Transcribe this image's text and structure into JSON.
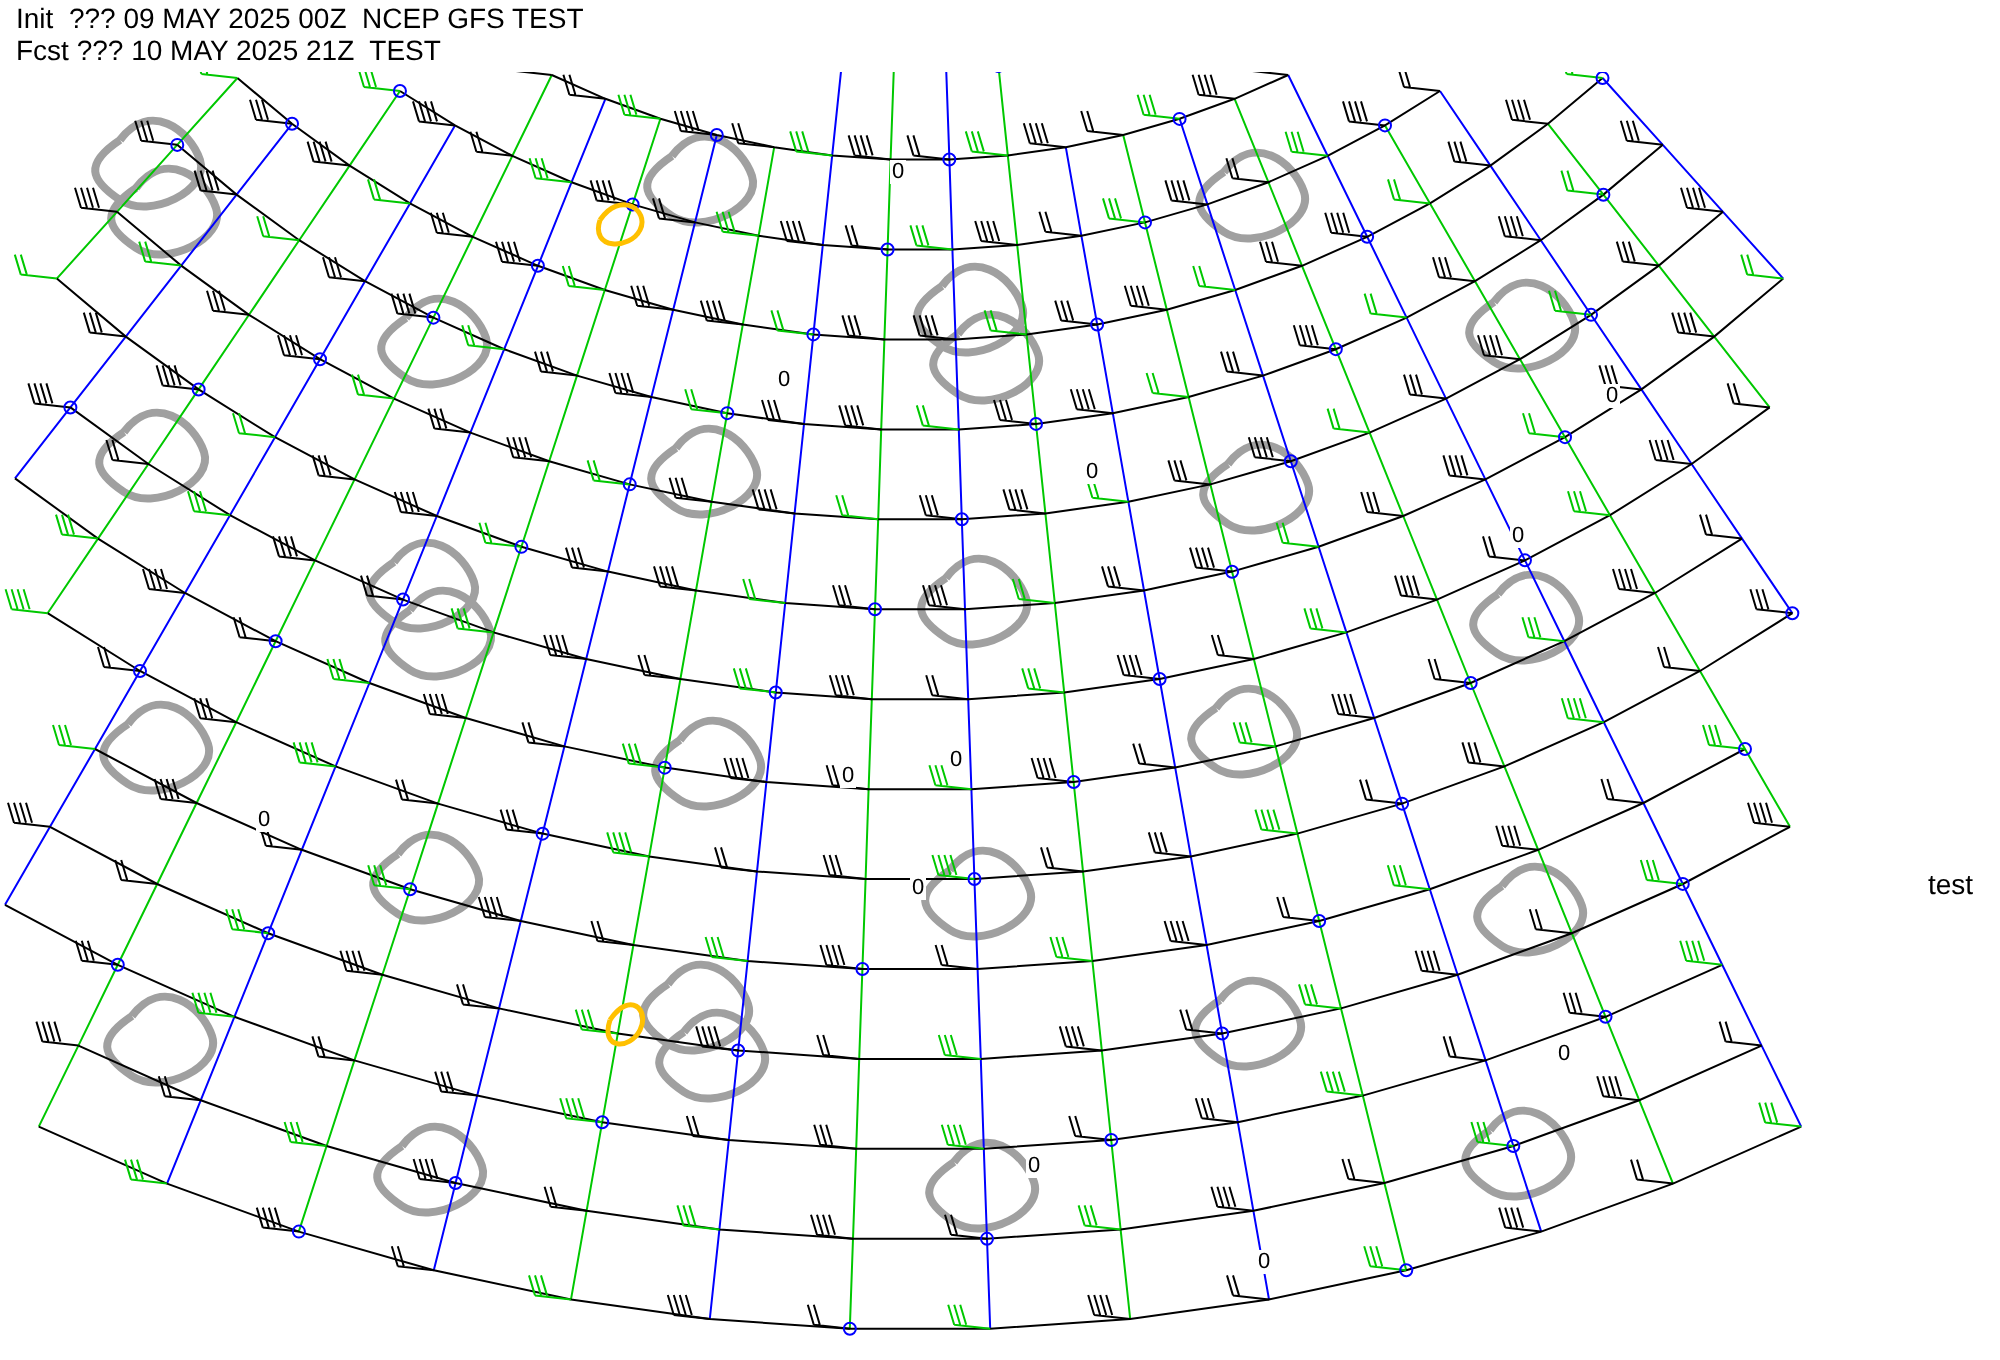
{
  "header": {
    "init_line": "Init  ??? 09 MAY 2025 00Z  NCEP GFS TEST",
    "forecast_line": "Fcst ??? 10 MAY 2025 21Z  TEST"
  },
  "side_label": "test",
  "contour_labels": [
    "0",
    "0",
    "0",
    "0",
    "0",
    "0",
    "0",
    "0",
    "0",
    "0",
    "0",
    "0"
  ]
}
